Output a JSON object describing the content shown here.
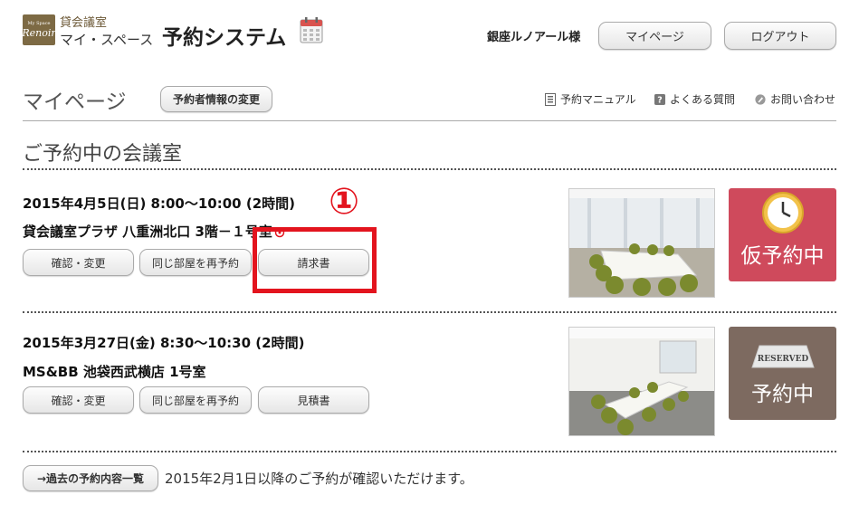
{
  "header": {
    "logo_small_text": "My Space",
    "logo_script_text": "Renoir",
    "brand_top": "貸会議室",
    "brand_bottom": "マイ・スペース",
    "system_title": "予約システム",
    "user_name": "銀座ルノアール様",
    "mypage_label": "マイページ",
    "logout_label": "ログアウト"
  },
  "page": {
    "title": "マイページ",
    "edit_info_label": "予約者情報の変更",
    "help_links": [
      {
        "label": "予約マニュアル",
        "icon": "manual-icon"
      },
      {
        "label": "よくある質問",
        "icon": "question-icon"
      },
      {
        "label": "お問い合わせ",
        "icon": "contact-icon"
      }
    ],
    "section_title": "ご予約中の会議室"
  },
  "reservations": [
    {
      "date": "2015年4月5日(日) 8:00～10:00 (2時間)",
      "room": "貸会議室プラザ 八重洲北口 3階－１号室",
      "buttons": [
        "確認・変更",
        "同じ部屋を再予約",
        "請求書"
      ],
      "status": "仮予約中",
      "status_color": "#cf4a5c"
    },
    {
      "date": "2015年3月27日(金) 8:30～10:30 (2時間)",
      "room": "MS&BB 池袋西武横店 1号室",
      "buttons": [
        "確認・変更",
        "同じ部屋を再予約",
        "見積書"
      ],
      "status": "予約中",
      "status_badge": "RESERVED",
      "status_color": "#7d6a60"
    }
  ],
  "annotation": {
    "number": "①",
    "color": "#e3141e"
  },
  "footer": {
    "past_button_label": "→過去の予約内容一覧",
    "past_note": "2015年2月1日以降のご予約が確認いただけます。"
  }
}
